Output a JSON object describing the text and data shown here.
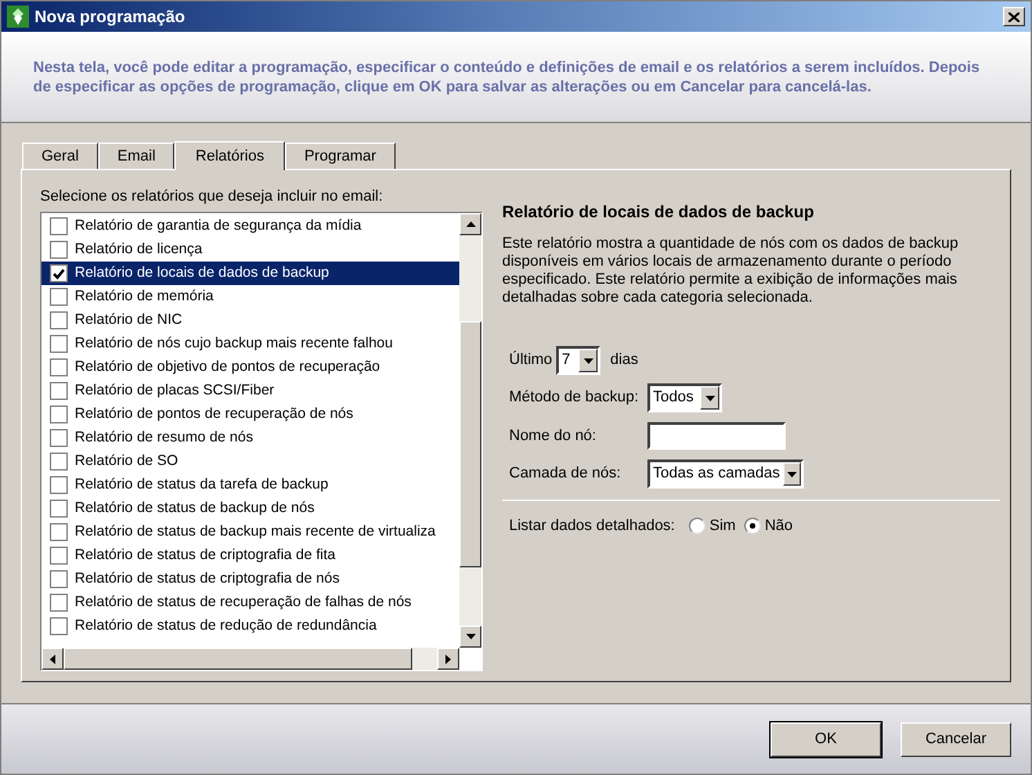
{
  "window": {
    "title": "Nova programação"
  },
  "intro": "Nesta tela, você pode editar a programação, especificar o conteúdo e definições de email e os relatórios a serem incluídos. Depois de especificar as opções de programação, clique em OK para salvar as alterações ou em Cancelar para cancelá-las.",
  "tabs": [
    {
      "label": "Geral",
      "selected": false
    },
    {
      "label": "Email",
      "selected": false
    },
    {
      "label": "Relatórios",
      "selected": true
    },
    {
      "label": "Programar",
      "selected": false
    }
  ],
  "list_label": "Selecione os relatórios que deseja incluir no email:",
  "reports": [
    {
      "label": "Relatório de garantia de segurança da mídia",
      "checked": false,
      "selected": false
    },
    {
      "label": "Relatório de licença",
      "checked": false,
      "selected": false
    },
    {
      "label": "Relatório de locais de dados de backup",
      "checked": true,
      "selected": true
    },
    {
      "label": "Relatório de memória",
      "checked": false,
      "selected": false
    },
    {
      "label": "Relatório de NIC",
      "checked": false,
      "selected": false
    },
    {
      "label": "Relatório de nós cujo backup mais recente falhou",
      "checked": false,
      "selected": false
    },
    {
      "label": "Relatório de objetivo de pontos de recuperação",
      "checked": false,
      "selected": false
    },
    {
      "label": "Relatório de placas SCSI/Fiber",
      "checked": false,
      "selected": false
    },
    {
      "label": "Relatório de pontos de recuperação de nós",
      "checked": false,
      "selected": false
    },
    {
      "label": "Relatório de resumo de nós",
      "checked": false,
      "selected": false
    },
    {
      "label": "Relatório de SO",
      "checked": false,
      "selected": false
    },
    {
      "label": "Relatório de status da tarefa de backup",
      "checked": false,
      "selected": false
    },
    {
      "label": "Relatório de status de backup de nós",
      "checked": false,
      "selected": false
    },
    {
      "label": "Relatório de status de backup mais recente de virtualiza",
      "checked": false,
      "selected": false
    },
    {
      "label": "Relatório de status de criptografia de fita",
      "checked": false,
      "selected": false
    },
    {
      "label": "Relatório de status de criptografia de nós",
      "checked": false,
      "selected": false
    },
    {
      "label": "Relatório de status de recuperação de falhas de nós",
      "checked": false,
      "selected": false
    },
    {
      "label": "Relatório de status de redução de redundância",
      "checked": false,
      "selected": false
    }
  ],
  "details": {
    "title": "Relatório de locais de dados de backup",
    "description": "Este relatório mostra a quantidade de nós com os dados de backup disponíveis em vários locais de armazenamento durante o período especificado. Este relatório permite a exibição de informações mais detalhadas sobre cada categoria selecionada.",
    "last_label": "Último",
    "last_value": "7",
    "last_unit": "dias",
    "method_label": "Método de backup:",
    "method_value": "Todos",
    "node_label": "Nome do nó:",
    "tier_label": "Camada de nós:",
    "tier_value": "Todas as camadas",
    "detail_label": "Listar dados detalhados:",
    "detail_options": [
      {
        "label": "Sim",
        "selected": false
      },
      {
        "label": "Não",
        "selected": true
      }
    ]
  },
  "buttons": [
    "OK",
    "Cancelar"
  ]
}
